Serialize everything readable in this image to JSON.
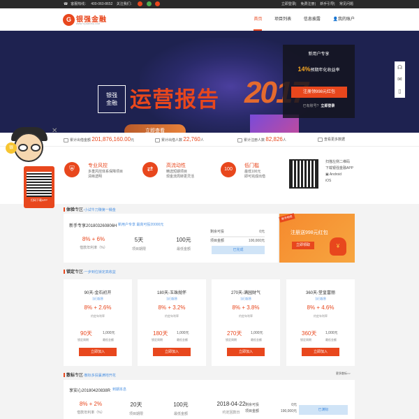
{
  "topbar": {
    "hotline_label": "客服热线：",
    "hotline": "400-060-8652",
    "follow_label": "关注我们：",
    "links": [
      "立即登录",
      "免费注册",
      "新手引导",
      "常见问题"
    ]
  },
  "header": {
    "logo_mark": "G",
    "logo_text": "银强金融",
    "logo_sub": "WWW.YQJHRONG.COM",
    "nav": [
      "首页",
      "项目列表",
      "信息披露",
      "我的账户"
    ],
    "nav_active": 0
  },
  "banner": {
    "brand": [
      "银强",
      "金融"
    ],
    "title": "运营报告",
    "button": "立即查看",
    "year": "2017",
    "dots": 7,
    "dot_active": 0,
    "promo": {
      "head": "新用户专享",
      "rate": "14%",
      "rate_text": "预期年化收益率",
      "button": "注册领998元红包",
      "login_text": "已有账号?",
      "login_link": "立即登录"
    }
  },
  "side_tools": [
    "headset-icon",
    "chat-icon",
    "phone-icon"
  ],
  "stats": [
    {
      "label": "累计出借金额",
      "value": "201,876,160.00",
      "unit": "元"
    },
    {
      "label": "累计出借人数",
      "value": "22,760",
      "unit": "人"
    },
    {
      "label": "累计注册人数",
      "value": "82,826",
      "unit": "人"
    },
    {
      "label": "查看更多数据",
      "value": "",
      "unit": ""
    }
  ],
  "features": [
    {
      "icon": "shield-icon",
      "title": "专业风控",
      "lines": [
        "多重风控体系保障项目",
        "清晰透明"
      ]
    },
    {
      "icon": "exchange-icon",
      "title": "高流动性",
      "lines": [
        "精选短期项目",
        "现金流周转更灵活"
      ]
    },
    {
      "icon": "hundred-icon",
      "title": "低门槛",
      "lines": [
        "最低100元",
        "即可完成出借"
      ]
    }
  ],
  "app": {
    "lines": [
      "扫描左侧二维码",
      "下载银强金融APP",
      "Android",
      "iOS"
    ]
  },
  "mascot": {
    "badge": "银",
    "label": "扫码下载APP"
  },
  "trial": {
    "section": "体验",
    "section_suffix": "专区",
    "section_sub": "-小试牛刀赚第一桶金",
    "id": "新手专享20180326080​6H",
    "tags": "新用户专享 最高可投20000元",
    "rate": "8% + 6%",
    "rate_label": "借款年利率（%）",
    "days": "5天",
    "days_label": "项目期限",
    "min": "100元",
    "min_label": "最低金额",
    "remain_label": "剩余可投",
    "remain_value": "0元",
    "total_label": "项目金额",
    "total_value": "100,000元",
    "button": "已完成"
  },
  "newbie": {
    "tag": "新手特权",
    "text": "注册送998元红包",
    "button": "立即领取",
    "bag": "¥"
  },
  "fixed": {
    "section": "锁定",
    "section_suffix": "专区",
    "section_sub": "-一步到位锁定高收益",
    "cards": [
      {
        "title": "90天-金石初开",
        "tag": "当日起息",
        "rate": "8% + 2.6%",
        "rate_label": "约定年利率",
        "days": "90天",
        "days_label": "锁定周期",
        "min": "1,000元",
        "min_label": "最低金额",
        "button": "立即加入"
      },
      {
        "title": "180天-玉珠抛怀",
        "tag": "当日起息",
        "rate": "8% + 3.2%",
        "rate_label": "约定年利率",
        "days": "180天",
        "days_label": "锁定周期",
        "min": "1,000元",
        "min_label": "最低金额",
        "button": "立即加入"
      },
      {
        "title": "270天-满园财气",
        "tag": "当日起息",
        "rate": "8% + 3.8%",
        "rate_label": "约定年利率",
        "days": "270天",
        "days_label": "锁定周期",
        "min": "1,000元",
        "min_label": "最低金额",
        "button": "立即加入"
      },
      {
        "title": "360天-堂皇富丽",
        "tag": "当日起息",
        "rate": "8% + 4.6%",
        "rate_label": "约定年利率",
        "days": "360天",
        "days_label": "锁定周期",
        "min": "1,000元",
        "min_label": "最低金额",
        "button": "立即加入"
      }
    ]
  },
  "bid": {
    "section": "散标",
    "section_suffix": "专区",
    "section_sub": "-散标多投赢满地开花",
    "more": "更多散标>>",
    "id": "享安心20180420838R",
    "tag": "到期本息",
    "rate": "8% + 2%",
    "rate_label": "借款年利率（%）",
    "days": "20天",
    "days_label": "项目期限",
    "min": "100元",
    "min_label": "最低金额",
    "date": "2018-04-22",
    "date_label": "约定回款日",
    "remain_label": "剩余可投",
    "remain_value": "0元",
    "total_label": "项目金额",
    "total_value": "190,000元",
    "button": "已满标"
  }
}
